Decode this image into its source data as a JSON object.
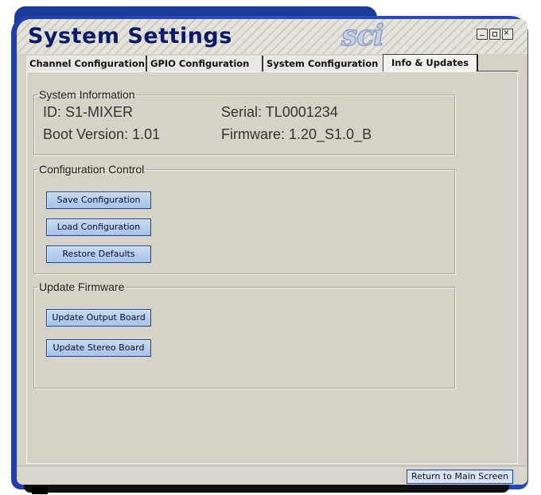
{
  "window": {
    "title": "System Settings",
    "logo": "sci"
  },
  "tabs": [
    {
      "label": "Channel Configuration",
      "active": false
    },
    {
      "label": "GPIO Configuration",
      "active": false
    },
    {
      "label": "System Configuration",
      "active": false
    },
    {
      "label": "Info & Updates",
      "active": true
    }
  ],
  "system_info": {
    "legend": "System Information",
    "id": "ID: S1-MIXER",
    "serial": "Serial: TL0001234",
    "boot_version": "Boot Version: 1.01",
    "firmware": "Firmware: 1.20_S1.0_B"
  },
  "config_control": {
    "legend": "Configuration Control",
    "save_label": "Save Configuration",
    "load_label": "Load Configuration",
    "restore_label": "Restore Defaults"
  },
  "update_firmware": {
    "legend": "Update Firmware",
    "output_label": "Update Output Board",
    "stereo_label": "Update Stereo Board"
  },
  "footer": {
    "return_label": "Return to Main Screen"
  },
  "colors": {
    "frame": "#2e4fc4",
    "window_bg": "#d6d2c8",
    "title_text": "#0a1a66",
    "button_fill": "#b6cfee",
    "button_border": "#1e3f9a"
  }
}
